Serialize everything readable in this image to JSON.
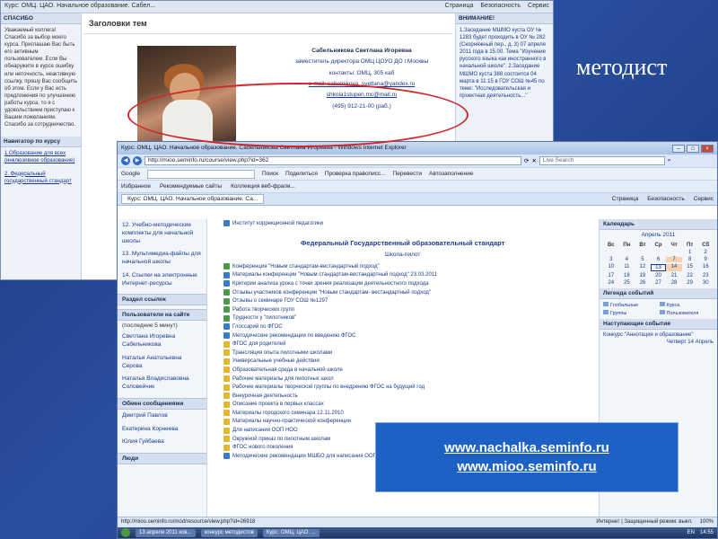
{
  "slide": {
    "title": "методист"
  },
  "back_page": {
    "topbar": {
      "title": "Курс: ОМЦ. ЦАО. Начальное образование. Сабел...",
      "tools": [
        "Страница",
        "Безопасность",
        "Сервис"
      ]
    },
    "left_block": {
      "header": "СПАСИБО",
      "text": "Уважаемый коллега! Спасибо за выбор моего курса. Приглашаю Вас быть его активным пользователем. Если Вы обнаружите в курсе ошибку или неточность, неактивную ссылку, прошу Вас сообщить об этом. Если у Вас есть предложения по улучшению работы курса, то я с удовольствием приступаю к Вашим пожеланиям. Спасибо за сотрудничество."
    },
    "nav_block": {
      "header": "Навигатор по курсу",
      "items": [
        "1.Образование для всех (инклюзивное образование)",
        "2. Федеральный государственный стандарт"
      ]
    },
    "main": {
      "section_title": "Заголовки тем"
    },
    "contact": {
      "name": "Сабельникова Светлана Игоревна",
      "position": "заместитель директора ОМЦ ЦОУО ДО г.Москвы",
      "contacts": "контакты: ОМЦ, 305 каб",
      "email1": "e-mail: sabelnikova_svetlana@yandex.ru",
      "email2": "shkola1stupen.mc@mail.ru",
      "phone": "(495) 912-21-00 (раб.)"
    },
    "right_block": {
      "header": "ВНИМАНИЕ!",
      "text": "1.Заседание МШМО куста ОУ № 1283 будет проходить в ОУ № 282 (Скорняжный пер., д. 3) 07 апреля 2011 года в 15.00. Тема \"Изучение русского языка как иностранного в начальной школе\". 2.Заседание МШМО куста 388 состоится 04 марта в 11:15 в ГОУ СОШ №45 по теме: \"Исследовательская и проектная деятельность...\""
    }
  },
  "ie": {
    "title": "Курс: ОМЦ. ЦАО. Начальное образование. Сабельникова Светлана Игоревна - Windows Internet Explorer",
    "address": "http://mioo.seminfo.ru/course/view.php?id=362",
    "search_placeholder": "Live Search",
    "google_bar": {
      "label": "Google",
      "items": [
        "Поиск",
        "Поделиться",
        "Проверка правописс...",
        "Перевести",
        "Автозаполнение"
      ]
    },
    "favorites": {
      "label": "Избранное",
      "items": [
        "Рекомендуемые сайты",
        "Коллекция веб-фрагм..."
      ]
    },
    "tab": "Курс: ОМЦ. ЦАО. Начальное образование. Са...",
    "tools": [
      "Страница",
      "Безопасность",
      "Сервис"
    ],
    "left": {
      "links": [
        "12. Учебно-методические комплекты для начальной школы",
        "13. Мультимедиа-файлы для начальной школы",
        "14. Ссылки на электронные Интернет-ресурсы"
      ],
      "links_header": "Раздел ссылок",
      "users_header": "Пользователи на сайте",
      "users_sub": "(последние 5 минут)",
      "users": [
        "Светлана Игоревна Сабельникова",
        "Наталья Анатольевна Серова",
        "Наталья Владиславовна Соловейчик"
      ],
      "messages_header": "Обмен сообщениями",
      "msg_users": [
        "Дмитрий Павлов",
        "Екатерина Корнеева",
        "Юлия Гуйбаева"
      ],
      "people_header": "Люди"
    },
    "main": {
      "top": "Институт коррекционной педагогики",
      "heading": "Федеральный Государственный образовательный стандарт",
      "subheading": "Школа-пилот",
      "items": [
        "Конференция \"Новым стандартам-вестандартный подход\"",
        "Материалы конференции \"Новым стандартам-вестандартный подход\" 23.03.2011",
        "Критерии анализа урока с точки зрения реализации деятельностного подхода",
        "Отзывы участников конференции \"Новым стандартам- вестандартный подход\"",
        "Отзывы о семинаре ГОУ СОШ №1297",
        "Работа творческих групп",
        "Трудности у \"пилотников\"",
        "Глоссарий по ФГОС",
        "Методические рекомендации по введению ФГОС",
        "ФГОС для родителей",
        "Трансляция опыта пилотными школами",
        "Универсальные учебные действия",
        "Образовательная среда в начальной школе",
        "Рабочие материалы для пилотных школ",
        "Рабочие материалы творческой группы по внедрению ФГОС на будущий год",
        "Внеурочная деятельность",
        "Описание проекта в первых классах",
        "Материалы городского семинара 12.11.2010",
        "Материалы научно-практической конференции",
        "Для написания ООП НОО",
        "Окружной приказ по пилотным школам",
        "ФГОС нового поколения",
        "Методические рекомендации МШБО для написания ООП НОО"
      ]
    },
    "right": {
      "calendar_header": "Календарь",
      "month": "Апрель 2011",
      "days": [
        "Вс",
        "Пн",
        "Вт",
        "Ср",
        "Чт",
        "Пт",
        "Сб"
      ],
      "dates": [
        "",
        "",
        "",
        "",
        "",
        "1",
        "2",
        "3",
        "4",
        "5",
        "6",
        "7",
        "8",
        "9",
        "10",
        "11",
        "12",
        "13",
        "14",
        "15",
        "16",
        "17",
        "18",
        "19",
        "20",
        "21",
        "22",
        "23",
        "24",
        "25",
        "26",
        "27",
        "28",
        "29",
        "30"
      ],
      "legend_header": "Легенда событий",
      "legend": [
        "Глобальные",
        "Курса",
        "Группы",
        "Пользователя"
      ],
      "events_header": "Наступающие события",
      "event_title": "Конкурс \"Аннотация и образование\"",
      "event_date": "Четверг 14 Апрель"
    },
    "status": {
      "url": "http://mioo.seminfo.ru/mod/resource/view.php?id=26918",
      "zone": "Интернет | Защищенный режим: выкл.",
      "zoom": "100%"
    },
    "taskbar": {
      "items": [
        "13 апреля 2011 ков...",
        "конкурс методистов",
        "Курс: ОМЦ. ЦАО. ..."
      ],
      "lang": "EN",
      "time": "14:55"
    }
  },
  "links_box": {
    "url1": "www.nachalka.seminfo.ru",
    "url2": "www.mioo.seminfo.ru"
  }
}
